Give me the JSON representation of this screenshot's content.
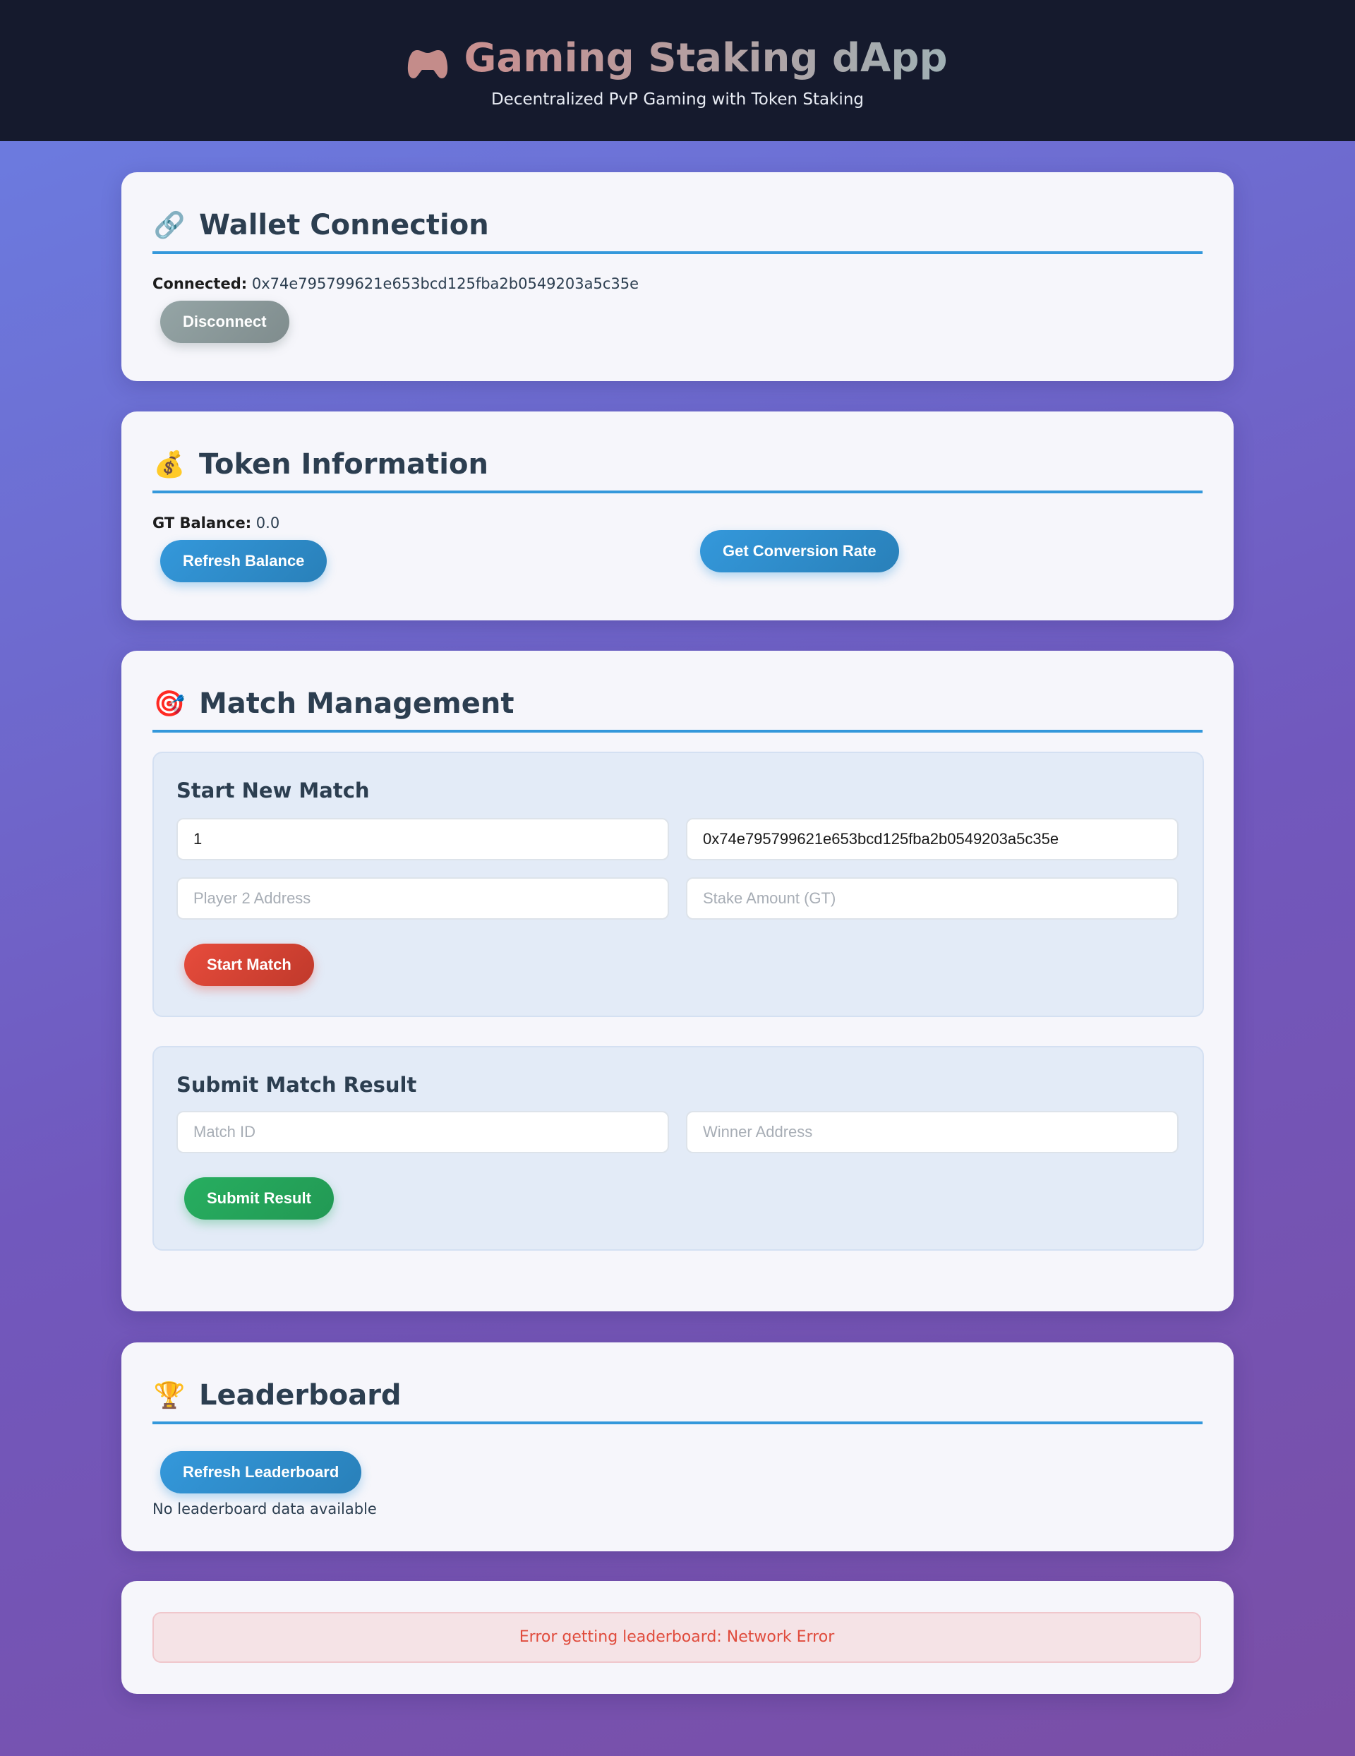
{
  "header": {
    "title": "Gaming Staking dApp",
    "subtitle": "Decentralized PvP Gaming with Token Staking",
    "icon": "gamepad-icon"
  },
  "wallet": {
    "title": "Wallet Connection",
    "icon": "link-icon",
    "connected_label": "Connected:",
    "address": "0x74e795799621e653bcd125fba2b0549203a5c35e",
    "disconnect_label": "Disconnect"
  },
  "token": {
    "title": "Token Information",
    "icon": "money-bag-icon",
    "balance_label": "GT Balance:",
    "balance_value": "0.0",
    "refresh_label": "Refresh Balance",
    "conversion_label": "Get Conversion Rate"
  },
  "match": {
    "title": "Match Management",
    "icon": "target-icon",
    "start": {
      "heading": "Start New Match",
      "match_id_value": "1",
      "player1_value": "0x74e795799621e653bcd125fba2b0549203a5c35e",
      "player2_placeholder": "Player 2 Address",
      "stake_placeholder": "Stake Amount (GT)",
      "button_label": "Start Match"
    },
    "submit": {
      "heading": "Submit Match Result",
      "match_id_placeholder": "Match ID",
      "winner_placeholder": "Winner Address",
      "button_label": "Submit Result"
    }
  },
  "leaderboard": {
    "title": "Leaderboard",
    "icon": "trophy-icon",
    "refresh_label": "Refresh Leaderboard",
    "empty_text": "No leaderboard data available"
  },
  "status": {
    "error_text": "Error getting leaderboard: Network Error"
  },
  "colors": {
    "accent": "#3498db",
    "danger": "#e74c3c",
    "success": "#27ae60",
    "header_bg": "#151a2d"
  }
}
